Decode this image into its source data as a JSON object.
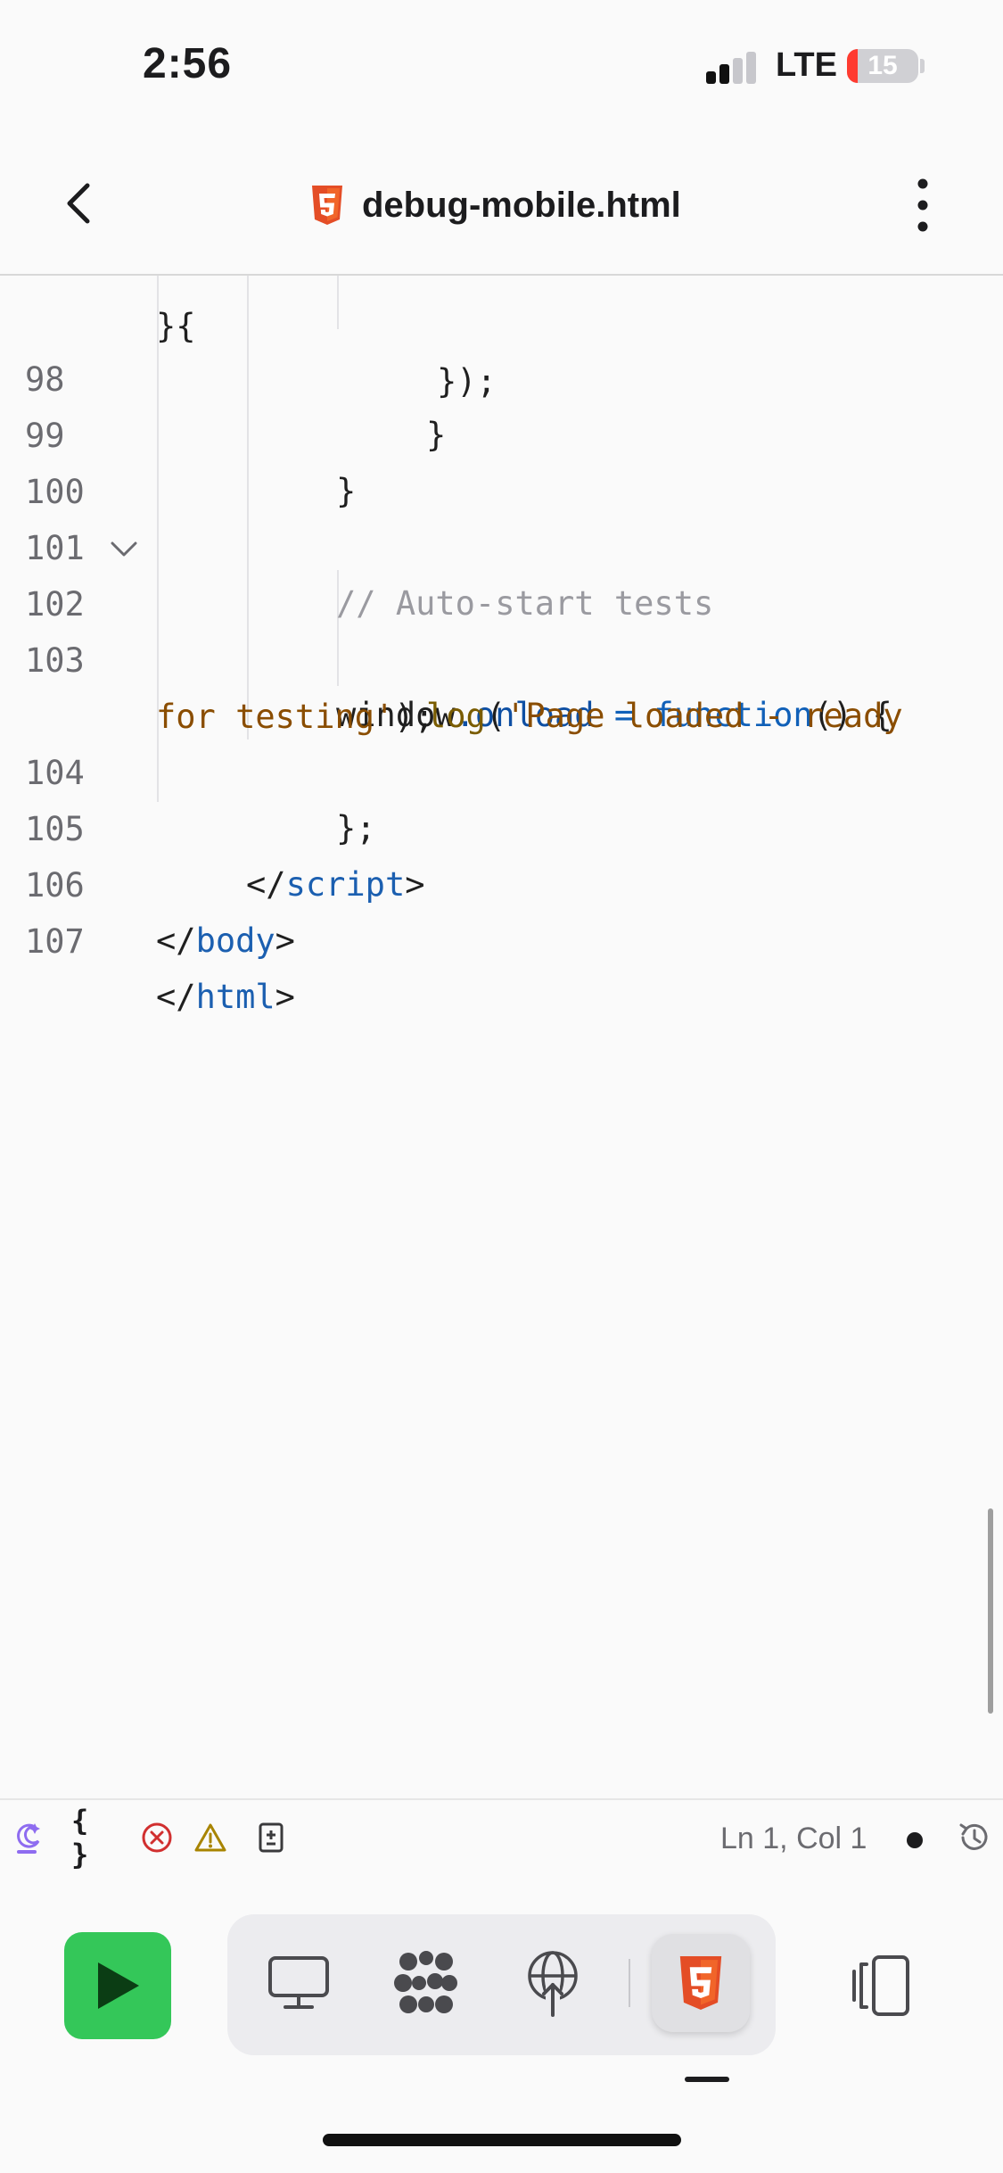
{
  "status_bar": {
    "time": "2:56",
    "network": "LTE",
    "battery": "15"
  },
  "header": {
    "file_name": "debug-mobile.html",
    "back_icon": "chevron-left-icon",
    "more_icon": "vertical-ellipsis-icon",
    "file_icon": "html5-icon"
  },
  "editor": {
    "lines": [
      {
        "n": "98"
      },
      {
        "n": "99"
      },
      {
        "n": "100"
      },
      {
        "n": "101"
      },
      {
        "n": "102"
      },
      {
        "n": "103"
      },
      {
        "n": "104"
      },
      {
        "n": "105"
      },
      {
        "n": "106"
      },
      {
        "n": "107"
      }
    ],
    "tokens": {
      "l98": "}",
      "l99": "}",
      "l101_comment": "// Auto-start tests",
      "l102_obj": "window",
      "l102_prop": ".onload",
      "l102_eq": " = ",
      "l102_kw": "function",
      "l102_rest": "() {",
      "l103_fn": "log",
      "l103_paren": "(",
      "l103_str": "'Page loaded - ready",
      "l103_str2": "for testing'",
      "l103_end": ");",
      "l104": "};",
      "l105_open": "</",
      "l105_tag": "script",
      "l105_close": ">",
      "l106_open": "</",
      "l106_tag": "body",
      "l106_close": ">",
      "l107_open": "</",
      "l107_tag": "html",
      "l107_close": ">"
    },
    "colors": {
      "comment": "#9a9aa0",
      "property": "#0e4fa3",
      "keyword": "#1060b8",
      "string": "#8a4d00",
      "tag": "#1b5fb0"
    }
  },
  "toolbar": {
    "braces": "{ }",
    "cursor": "Ln 1, Col 1",
    "icons": [
      "ai-assist-icon",
      "format-braces-icon",
      "error-icon",
      "warning-icon",
      "diff-icon",
      "unsaved-dot-icon",
      "history-icon"
    ]
  },
  "bottom_bar": {
    "icons": [
      "run-icon",
      "desktop-preview-icon",
      "multi-dot-icon",
      "network-icon",
      "html5-icon",
      "split-layout-icon"
    ],
    "run_color": "#34c759",
    "html_color": "#e44d26"
  }
}
